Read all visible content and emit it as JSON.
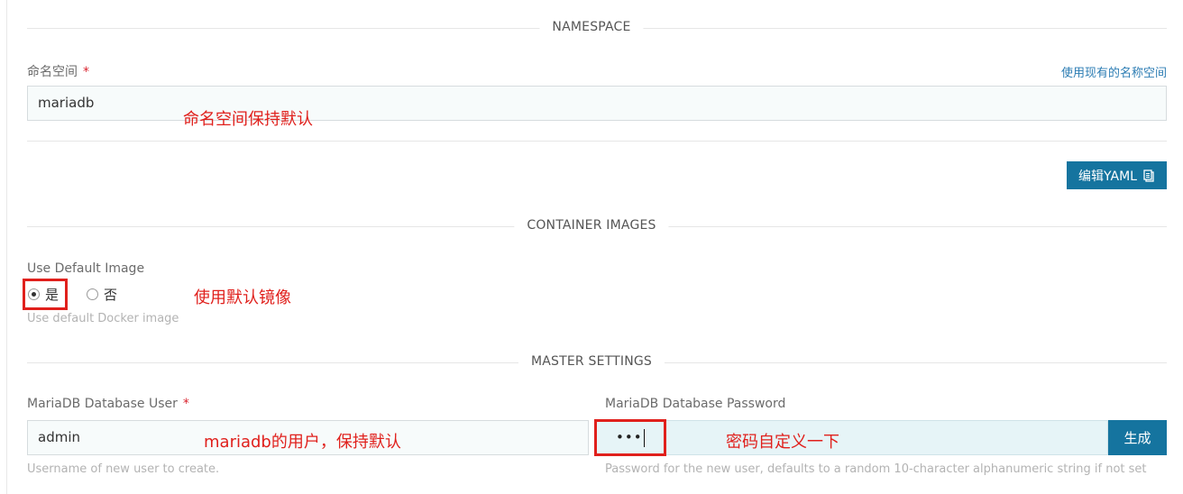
{
  "sections": {
    "namespace": "NAMESPACE",
    "container_images": "CONTAINER IMAGES",
    "master_settings": "MASTER SETTINGS"
  },
  "namespace": {
    "label": "命名空间",
    "required_mark": "*",
    "use_existing_link": "使用现有的名称空间",
    "value": "mariadb",
    "annotation": "命名空间保持默认"
  },
  "edit_yaml": {
    "label": "编辑YAML",
    "icon": "clipboard-icon"
  },
  "default_image": {
    "label": "Use Default Image",
    "options": [
      "是",
      "否"
    ],
    "selected": "是",
    "help": "Use default Docker image",
    "annotation": "使用默认镜像"
  },
  "db_user": {
    "label": "MariaDB Database User",
    "required_mark": "*",
    "value": "admin",
    "help": "Username of new user to create.",
    "annotation": "mariadb的用户，保持默认"
  },
  "db_password": {
    "label": "MariaDB Database Password",
    "masked_value": "•••",
    "generate_label": "生成",
    "help": "Password for the new user, defaults to a random 10-character alphanumeric string if not set",
    "annotation": "密码自定义一下"
  },
  "colors": {
    "accent": "#15749f",
    "annotation_red": "#e0201c",
    "link": "#2b7cb3"
  }
}
